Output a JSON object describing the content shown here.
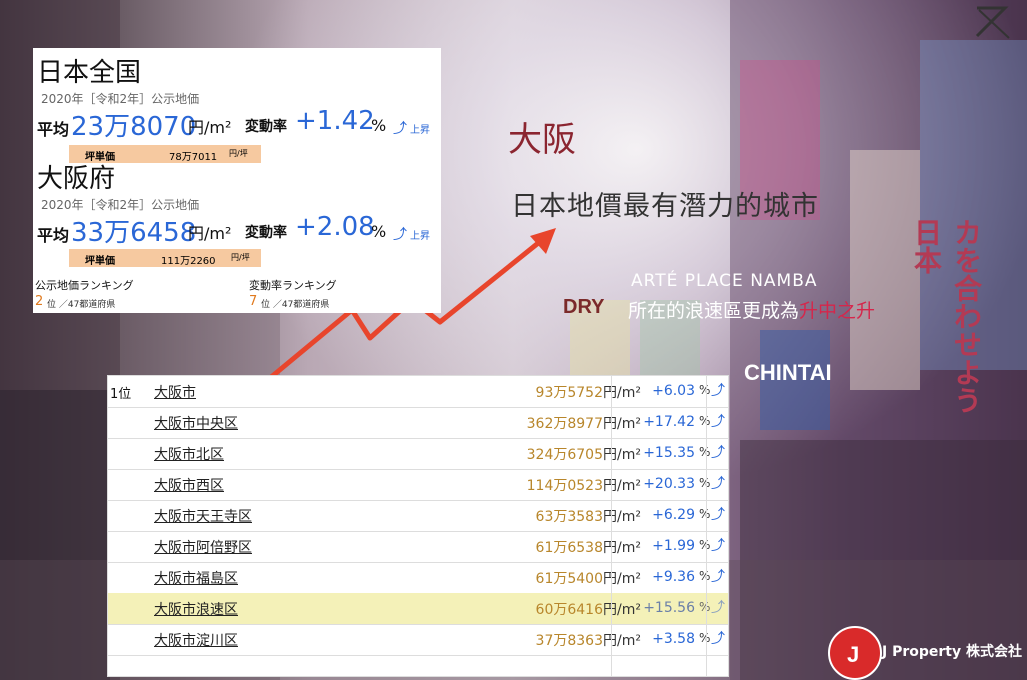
{
  "header": {
    "osaka_label": "大阪",
    "tagline": "日本地價最有潛力的城市",
    "project": "ARTÉ PLACE NAMBA",
    "project_desc_prefix": "所在的浪速區更成為",
    "project_desc_highlight": "升中之升"
  },
  "colors": {
    "accent_blue": "#2a67d6",
    "price_gold": "#b8862b",
    "highlight_red": "#d6264b",
    "brand_red": "#d92a2a"
  },
  "japan_card": {
    "japan": {
      "title": "日本全国",
      "subtitle": "2020年［令和2年］公示地価",
      "avg_label": "平均",
      "avg_value": "23万8070",
      "avg_unit": "円/m²",
      "rate_label": "変動率",
      "rate_value": "+1.42",
      "rate_unit": "%",
      "trend": "上昇",
      "tsubo_label": "坪単価",
      "tsubo_value": "78万7011",
      "tsubo_unit": "円/坪"
    },
    "osaka_pref": {
      "title": "大阪府",
      "subtitle": "2020年［令和2年］公示地価",
      "avg_label": "平均",
      "avg_value": "33万6458",
      "avg_unit": "円/m²",
      "rate_label": "変動率",
      "rate_value": "+2.08",
      "rate_unit": "%",
      "trend": "上昇",
      "tsubo_label": "坪単価",
      "tsubo_value": "111万2260",
      "tsubo_unit": "円/坪"
    },
    "ranking_label_1": "公示地価ランキング",
    "ranking_value_1": "2",
    "ranking_suffix_1": "位 ／47都道府県",
    "ranking_label_2": "変動率ランキング",
    "ranking_value_2": "7",
    "ranking_suffix_2": "位 ／47都道府県"
  },
  "table": {
    "rows": [
      {
        "rank": "1位",
        "name": "大阪市",
        "price": "93万5752",
        "unit": "円/m²",
        "change": "+6.03",
        "pct": "%"
      },
      {
        "rank": "",
        "name": "大阪市中央区",
        "price": "362万8977",
        "unit": "円/m²",
        "change": "+17.42",
        "pct": "%"
      },
      {
        "rank": "",
        "name": "大阪市北区",
        "price": "324万6705",
        "unit": "円/m²",
        "change": "+15.35",
        "pct": "%"
      },
      {
        "rank": "",
        "name": "大阪市西区",
        "price": "114万0523",
        "unit": "円/m²",
        "change": "+20.33",
        "pct": "%"
      },
      {
        "rank": "",
        "name": "大阪市天王寺区",
        "price": "63万3583",
        "unit": "円/m²",
        "change": "+6.29",
        "pct": "%"
      },
      {
        "rank": "",
        "name": "大阪市阿倍野区",
        "price": "61万6538",
        "unit": "円/m²",
        "change": "+1.99",
        "pct": "%"
      },
      {
        "rank": "",
        "name": "大阪市福島区",
        "price": "61万5400",
        "unit": "円/m²",
        "change": "+9.36",
        "pct": "%"
      },
      {
        "rank": "",
        "name": "大阪市浪速区",
        "price": "60万6416",
        "unit": "円/m²",
        "change": "+15.56",
        "pct": "%"
      },
      {
        "rank": "",
        "name": "大阪市淀川区",
        "price": "37万8363",
        "unit": "円/m²",
        "change": "+3.58",
        "pct": "%"
      }
    ],
    "highlighted_row": 7
  },
  "brand": {
    "logo_letter": "J",
    "name": "J Property 株式会社"
  },
  "background_signs": {
    "sign_1": "カを合わせよう日本",
    "sign_2": "CHINTAI",
    "sign_3": "DRY"
  }
}
